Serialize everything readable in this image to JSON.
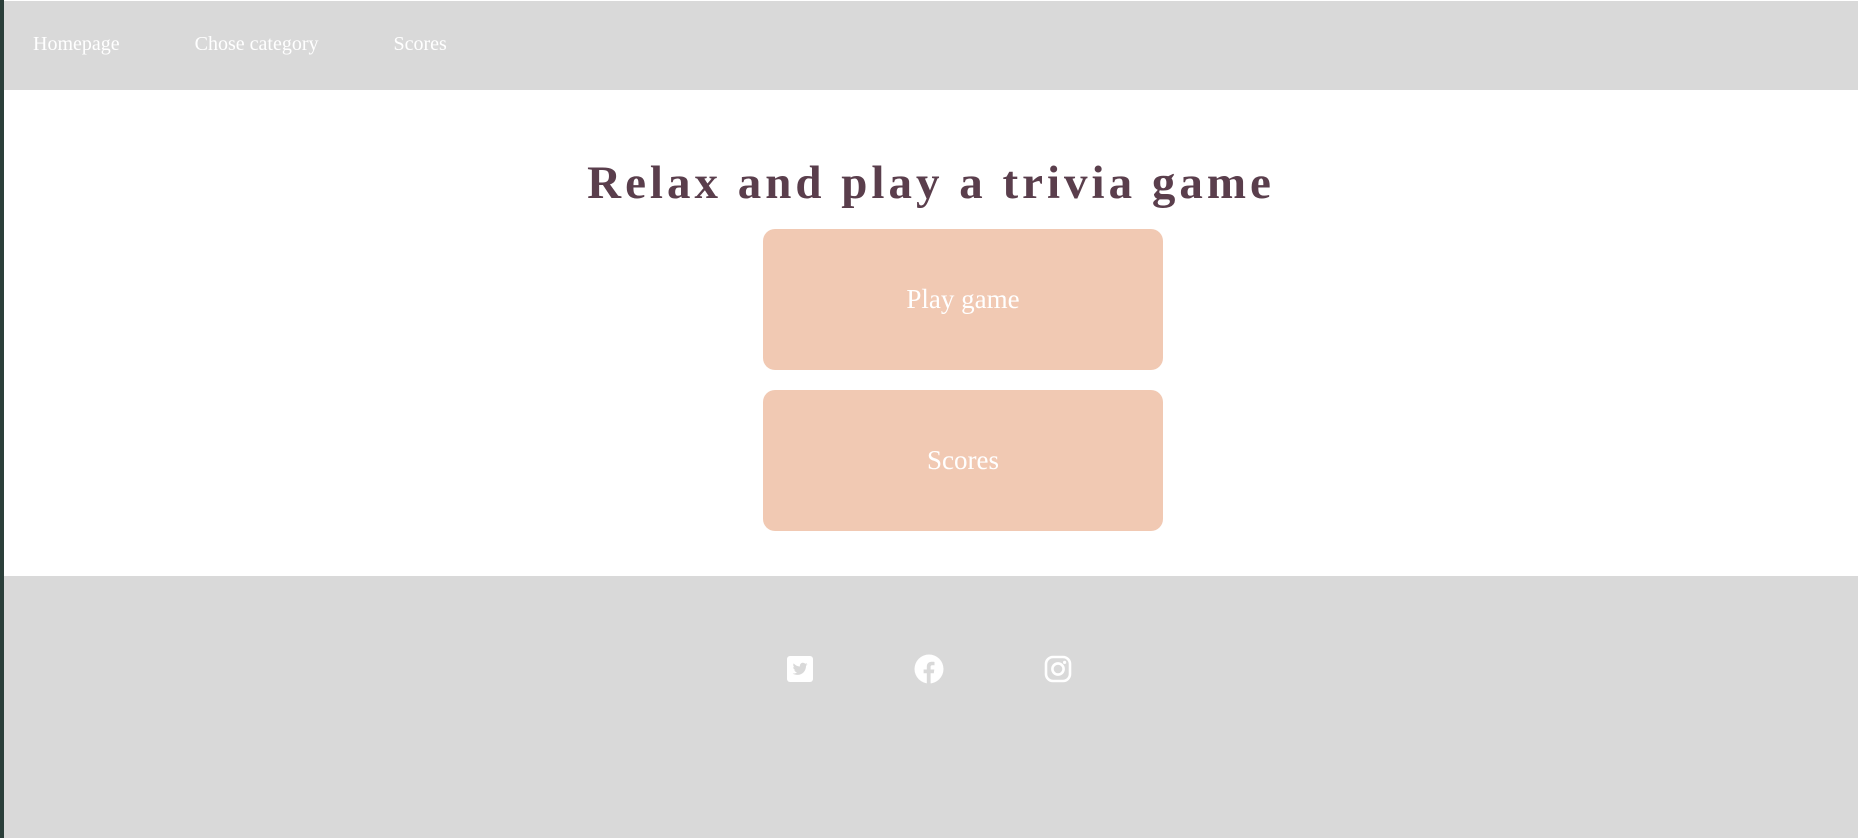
{
  "nav": {
    "items": [
      {
        "label": "Homepage"
      },
      {
        "label": "Chose category"
      },
      {
        "label": "Scores"
      }
    ]
  },
  "main": {
    "title": "Relax and play a trivia game",
    "play_button": "Play game",
    "scores_button": "Scores"
  },
  "footer": {
    "social": [
      {
        "icon": "twitter-icon"
      },
      {
        "icon": "facebook-icon"
      },
      {
        "icon": "instagram-icon"
      }
    ]
  },
  "colors": {
    "bar_bg": "#d9d9d9",
    "title": "#5a3e4c",
    "button_bg": "#f1c9b3",
    "text_light": "#ffffff"
  }
}
